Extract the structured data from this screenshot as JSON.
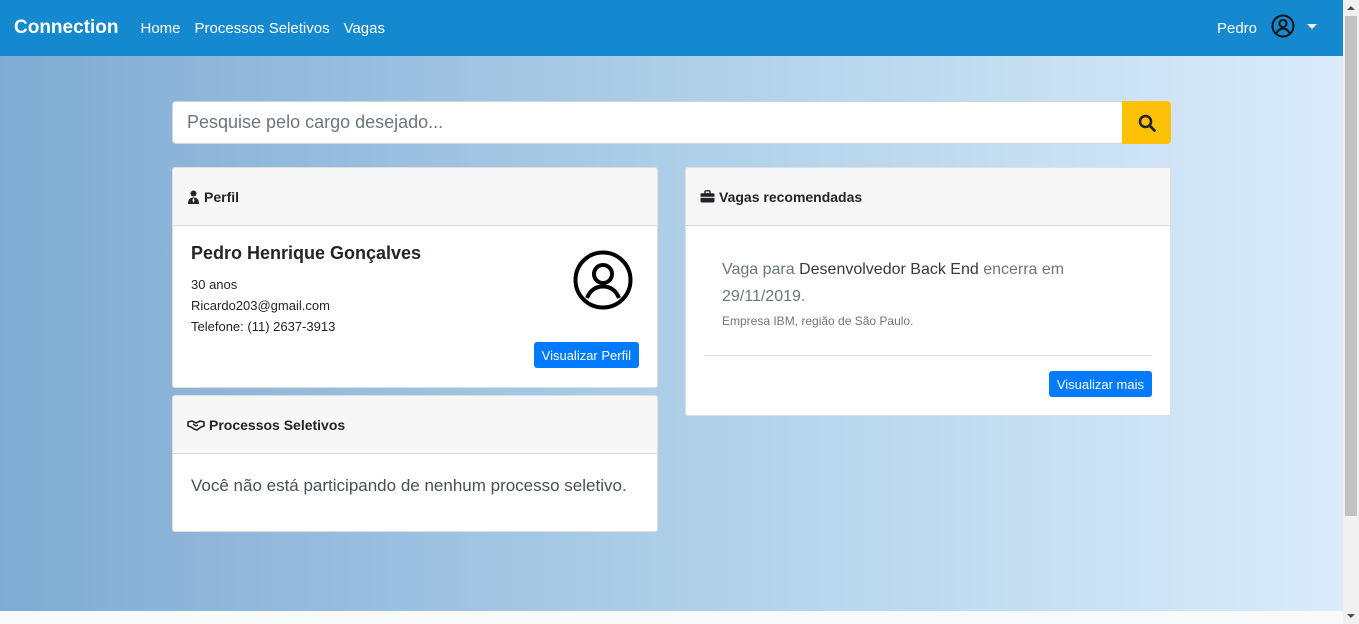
{
  "navbar": {
    "brand": "Connection",
    "links": [
      "Home",
      "Processos Seletivos",
      "Vagas"
    ],
    "user_name": "Pedro",
    "user_icon": "user-circle-icon"
  },
  "search": {
    "placeholder": "Pesquise pelo cargo desejado...",
    "button_icon": "search-icon"
  },
  "profile": {
    "header": "Perfil",
    "header_icon": "user-tie-icon",
    "name": "Pedro Henrique Gonçalves",
    "age": "30 anos",
    "email": "Ricardo203@gmail.com",
    "phone": "Telefone: (11) 2637-3913",
    "button": "Visualizar Perfil"
  },
  "processes": {
    "header": "Processos Seletivos",
    "header_icon": "handshake-icon",
    "message": "Você não está participando de nenhum processo seletivo."
  },
  "jobs": {
    "header": "Vagas recomendadas",
    "header_icon": "briefcase-icon",
    "prefix": "Vaga para ",
    "role": "Desenvolvedor Back End",
    "suffix": " encerra em",
    "date": "29/11/2019.",
    "company": "Empresa IBM, região de São Paulo.",
    "button": "Visualizar mais"
  },
  "colors": {
    "navbar": "#1589cf",
    "primary": "#007bff",
    "search_button": "#ffc107"
  }
}
